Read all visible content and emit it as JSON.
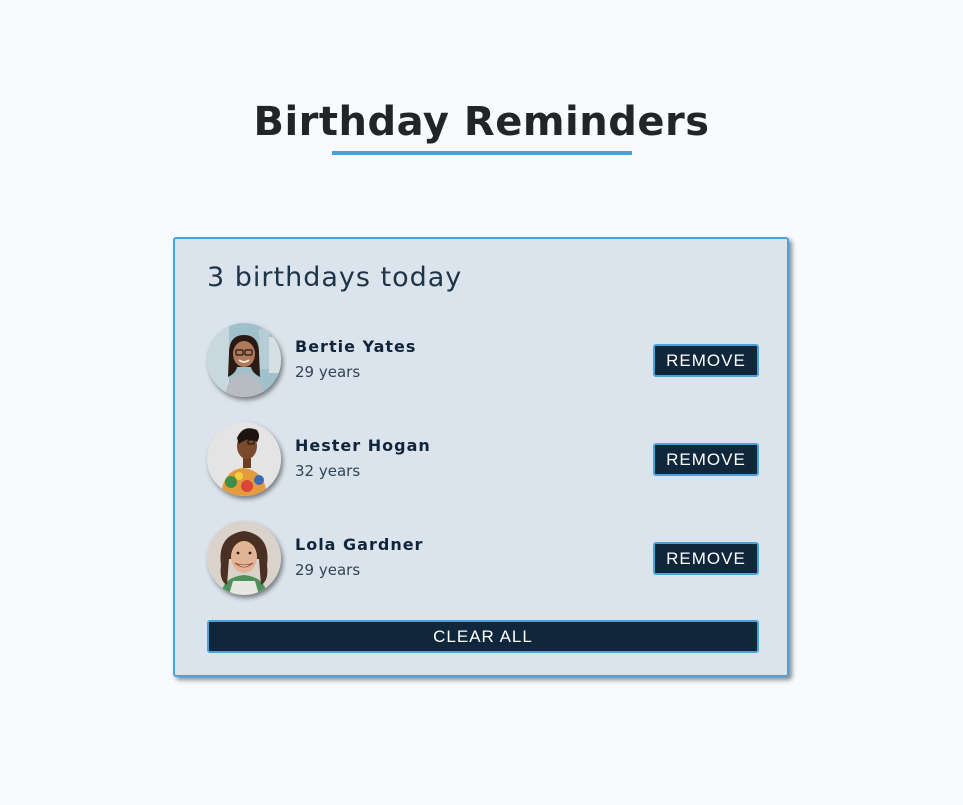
{
  "page": {
    "title": "Birthday Reminders"
  },
  "card": {
    "count_text": "3 birthdays today",
    "people": [
      {
        "name": "Bertie Yates",
        "age": "29 years",
        "remove_label": "REMOVE",
        "avatar": "woman-glasses-city-photo"
      },
      {
        "name": "Hester Hogan",
        "age": "32 years",
        "remove_label": "REMOVE",
        "avatar": "woman-braids-colorful-shirt-photo"
      },
      {
        "name": "Lola Gardner",
        "age": "29 years",
        "remove_label": "REMOVE",
        "avatar": "woman-curly-hair-smiling-photo"
      }
    ],
    "clear_label": "CLEAR ALL"
  },
  "colors": {
    "background": "#f8fafd",
    "card_bg": "#dbe3ec",
    "accent": "#4aa2d8",
    "button_bg": "#0f263b",
    "title_text": "#222428"
  }
}
